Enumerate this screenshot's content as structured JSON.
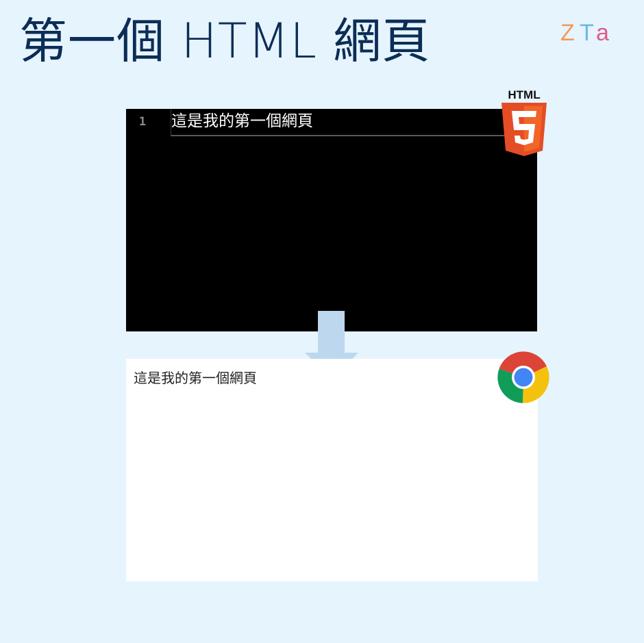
{
  "header": {
    "title": "第一個 HTML 網頁",
    "brand": "ZTA"
  },
  "editor": {
    "line_number": "1",
    "code": "這是我的第一個網頁",
    "badge_label": "HTML",
    "badge_digit": "5",
    "badge_icon": "html5-icon"
  },
  "arrow": {
    "icon": "arrow-down-icon"
  },
  "browser": {
    "content": "這是我的第一個網頁",
    "icon": "chrome-icon"
  },
  "colors": {
    "background": "#e6f4fd",
    "title": "#0c2d57",
    "html5_orange": "#e44d26",
    "html5_light": "#f16529",
    "arrow": "#bdd7ee",
    "brand_orange": "#f39a5a",
    "brand_blue": "#6fb8e0",
    "brand_pink": "#e05b8c"
  }
}
